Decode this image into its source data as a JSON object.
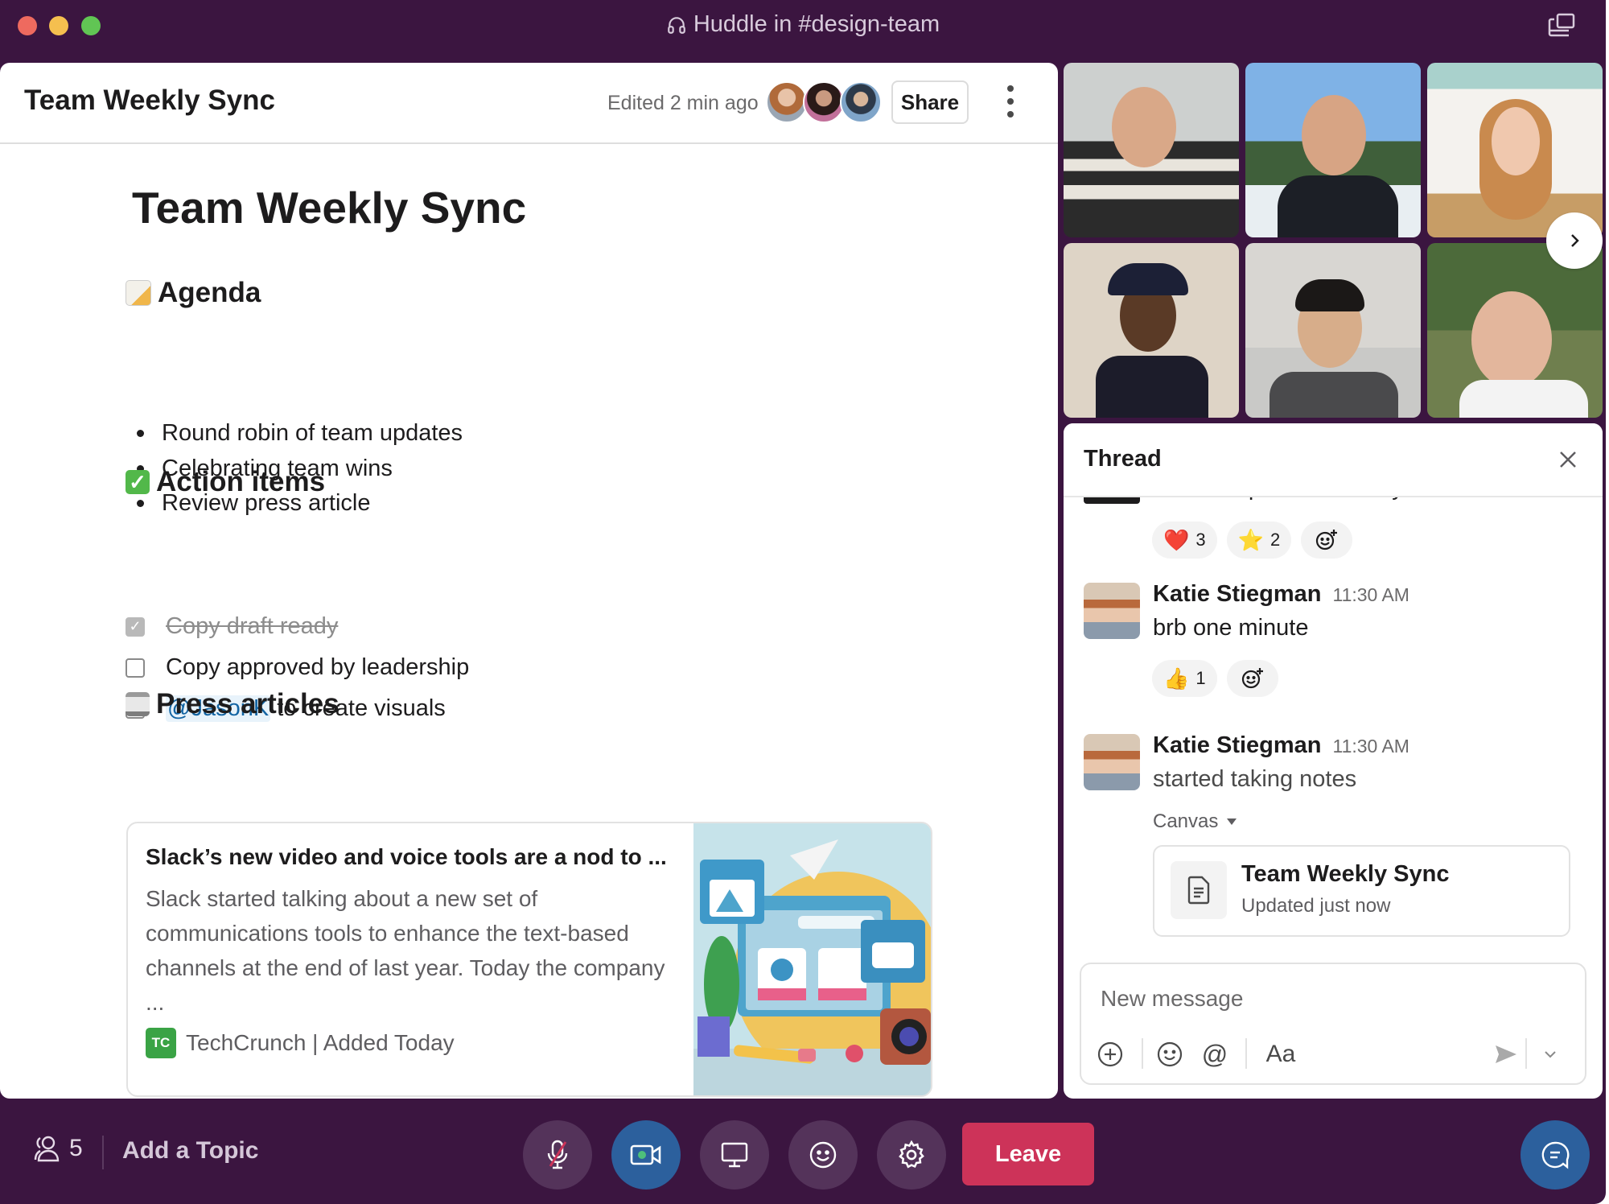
{
  "window": {
    "title": "Huddle in #design-team",
    "title_icon": "headphones-icon",
    "popout_icon": "popout-window-icon"
  },
  "doc": {
    "header_title": "Team Weekly Sync",
    "edited": "Edited 2 min ago",
    "collaborators": [
      "Katie Stiegman",
      "collaborator-2",
      "collaborator-3"
    ],
    "share_label": "Share",
    "more_icon": "kebab-menu-icon",
    "title": "Team Weekly Sync",
    "sections": {
      "agenda": {
        "emoji": "memo-emoji",
        "heading": "Agenda",
        "items": [
          "Round robin of team updates",
          "Celebrating team wins",
          "Review press article"
        ]
      },
      "action_items": {
        "emoji": "check-mark-button-emoji",
        "heading": "Action items",
        "tasks": [
          {
            "label": "Copy draft ready",
            "checked": true
          },
          {
            "label": "Copy approved by leadership",
            "checked": false
          },
          {
            "mention": "@JasonK",
            "label": " to create visuals",
            "checked": false
          }
        ]
      },
      "press": {
        "emoji": "newspaper-emoji",
        "heading": "Press articles",
        "article": {
          "title": "Slack’s new video and voice tools are a nod to ...",
          "description": "Slack started talking about a new set of communications tools to enhance the text-based channels at the end of last year. Today the company ...",
          "source_logo": "TC",
          "source": "TechCrunch | Added Today"
        }
      }
    }
  },
  "video": {
    "participants_shown": 6,
    "next_icon": "chevron-right-icon"
  },
  "thread": {
    "title": "Thread",
    "close_icon": "close-icon",
    "cutoff_text": "You rock pedro. Thank you.",
    "first_reactions": [
      {
        "emoji": "❤️",
        "name": "heart",
        "count": "3"
      },
      {
        "emoji": "⭐",
        "name": "star",
        "count": "2"
      }
    ],
    "messages": [
      {
        "author": "Katie Stiegman",
        "time": "11:30 AM",
        "text": "brb one minute",
        "reactions": [
          {
            "emoji": "👍",
            "name": "thumbs-up",
            "count": "1"
          }
        ]
      },
      {
        "author": "Katie Stiegman",
        "time": "11:30 AM",
        "text": "started taking notes",
        "attachment_label": "Canvas",
        "canvas": {
          "title": "Team Weekly Sync",
          "subtitle": "Updated just now"
        }
      }
    ],
    "composer": {
      "placeholder": "New message",
      "format_label": "Aa"
    }
  },
  "controls": {
    "participant_count": "5",
    "topic_label": "Add a Topic",
    "leave_label": "Leave",
    "colors": {
      "leave": "#cd3359",
      "video_active": "#2c609d",
      "background": "#3b1540"
    }
  }
}
